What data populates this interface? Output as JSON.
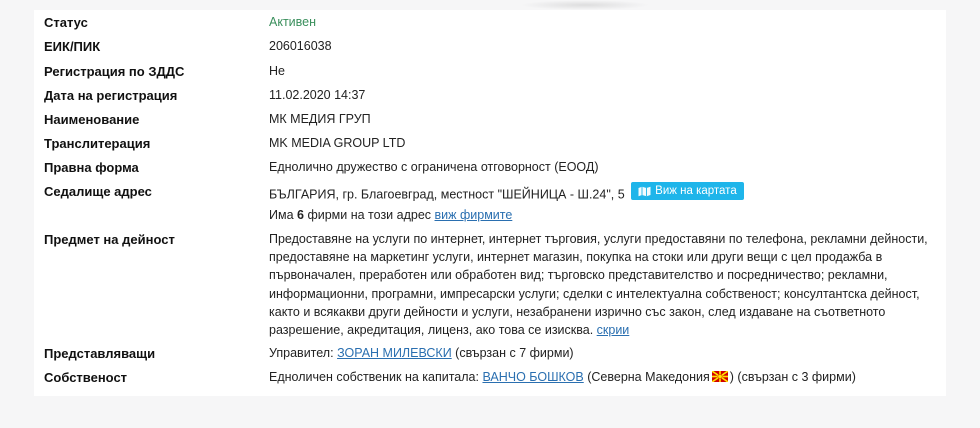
{
  "fields": {
    "status": {
      "label": "Статус",
      "value": "Активен"
    },
    "eik": {
      "label": "ЕИК/ПИК",
      "value": "206016038"
    },
    "vat": {
      "label": "Регистрация по ЗДДС",
      "value": "Не"
    },
    "reg_date": {
      "label": "Дата на регистрация",
      "value": "11.02.2020 14:37"
    },
    "name": {
      "label": "Наименование",
      "value": "МК МЕДИЯ ГРУП"
    },
    "translit": {
      "label": "Транслитерация",
      "value": "MK MEDIA GROUP LTD"
    },
    "legal_form": {
      "label": "Правна форма",
      "value": "Еднолично дружество с ограничена отговорност (ЕООД)"
    },
    "address": {
      "label": "Седалище адрес",
      "value": "БЪЛГАРИЯ, гр. Благоевград, местност \"ШЕЙНИЦА - Ш.24\", 5",
      "map_button": "Виж на картата",
      "firms_prefix": "Има",
      "firms_count": "6",
      "firms_suffix": "фирми на този адрес",
      "firms_link": "виж фирмите"
    },
    "activity": {
      "label": "Предмет на дейност",
      "value": "Предоставяне на услуги по интернет, интернет търговия, услуги предоставяни по телефона, рекламни дейности, предоставяне на маркетинг услуги, интернет магазин, покупка на стоки или други вещи с цел продажба в първоначален, преработен или обработен вид; търговско представителство и посредничество; рекламни, информационни, програмни, импресарски услуги; сделки с интелектуална собственост; консултантска дейност, както и всякакви други дейности и услуги, незабранени изрично със закон, след издаване на съответното разрешение, акредитация, лиценз, ако това се изисква.",
      "hide_link": "скрии"
    },
    "representatives": {
      "label": "Представляващи",
      "prefix": "Управител:",
      "person": "ЗОРАН МИЛЕВСКИ",
      "suffix": "(свързан с 7 фирми)"
    },
    "ownership": {
      "label": "Собственост",
      "prefix": "Едноличен собственик на капитала:",
      "person": "ВАНЧО БОШКОВ",
      "country": "(Северна Македония",
      "suffix": ") (свързан с 3 фирми)"
    }
  },
  "colors": {
    "active_status": "#3a8f5c",
    "link": "#2a6fb0",
    "map_button": "#1eb5ea"
  },
  "icons": {
    "map_button_icon": "map-icon",
    "country_flag": "north-macedonia-flag-icon"
  }
}
